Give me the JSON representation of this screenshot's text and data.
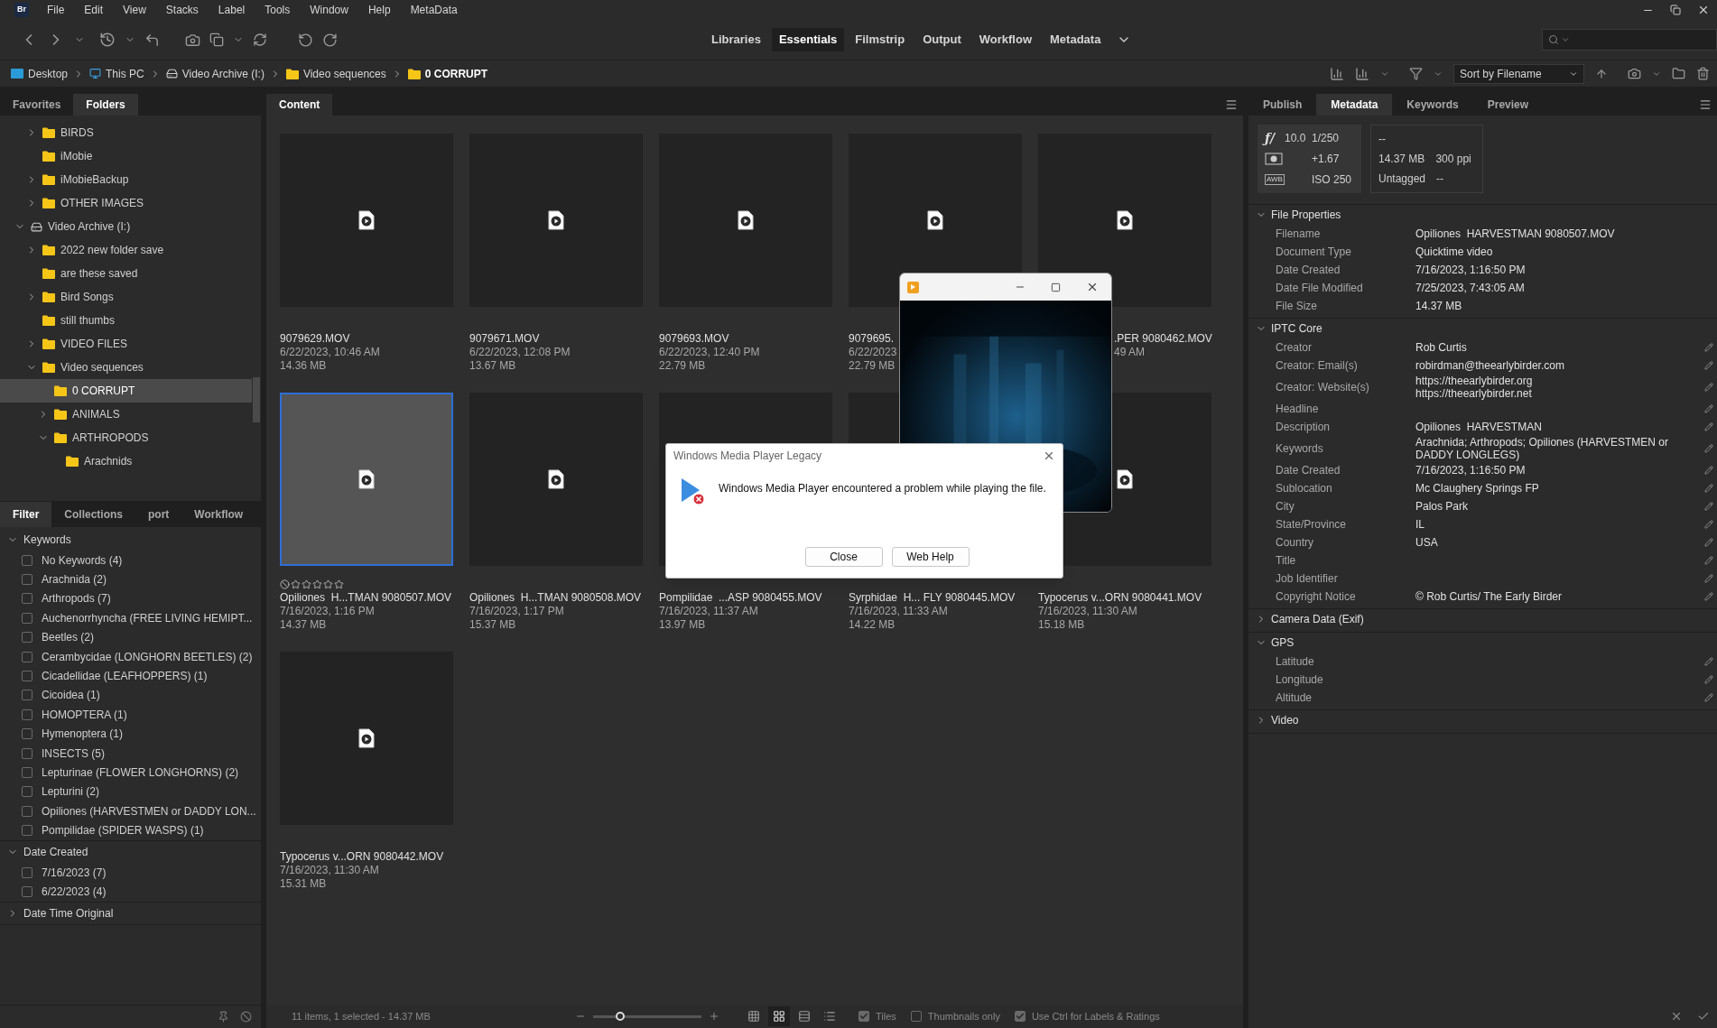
{
  "app": {
    "logo": "Br"
  },
  "menu": [
    "File",
    "Edit",
    "View",
    "Stacks",
    "Label",
    "Tools",
    "Window",
    "Help",
    "MetaData"
  ],
  "workspaces": [
    {
      "label": "Libraries",
      "selected": false
    },
    {
      "label": "Essentials",
      "selected": true
    },
    {
      "label": "Filmstrip",
      "selected": false
    },
    {
      "label": "Output",
      "selected": false
    },
    {
      "label": "Workflow",
      "selected": false
    },
    {
      "label": "Metadata",
      "selected": false
    }
  ],
  "path": [
    {
      "kind": "desktop",
      "label": "Desktop"
    },
    {
      "kind": "pc",
      "label": "This PC"
    },
    {
      "kind": "drive",
      "label": "Video Archive (I:)"
    },
    {
      "kind": "folder",
      "label": "Video sequences"
    },
    {
      "kind": "folder",
      "label": "0 CORRUPT"
    }
  ],
  "sort": {
    "value": "Sort by Filename"
  },
  "left_tabs": [
    {
      "label": "Favorites",
      "selected": false
    },
    {
      "label": "Folders",
      "selected": true
    }
  ],
  "folders": [
    {
      "kind": "folder",
      "label": "BIRDS",
      "expandable": true,
      "expanded": false,
      "selected": false
    },
    {
      "kind": "folder",
      "label": "iMobie",
      "expandable": false,
      "expanded": false,
      "selected": false
    },
    {
      "kind": "folder",
      "label": "iMobieBackup",
      "expandable": true,
      "expanded": false,
      "selected": false
    },
    {
      "kind": "folder",
      "label": "OTHER IMAGES",
      "expandable": true,
      "expanded": false,
      "selected": false
    },
    {
      "kind": "drive",
      "label": "Video Archive (I:)",
      "expandable": true,
      "expanded": true,
      "selected": false,
      "children": [
        {
          "kind": "folder",
          "label": "2022 new folder save",
          "expandable": true,
          "expanded": false,
          "selected": false
        },
        {
          "kind": "folder",
          "label": "are these saved",
          "expandable": false,
          "expanded": false,
          "selected": false
        },
        {
          "kind": "folder",
          "label": "Bird Songs",
          "expandable": true,
          "expanded": false,
          "selected": false
        },
        {
          "kind": "folder",
          "label": "still thumbs",
          "expandable": false,
          "expanded": false,
          "selected": false
        },
        {
          "kind": "folder",
          "label": "VIDEO FILES",
          "expandable": true,
          "expanded": false,
          "selected": false
        },
        {
          "kind": "folder",
          "label": "Video sequences",
          "expandable": true,
          "expanded": true,
          "selected": false,
          "children": [
            {
              "kind": "folder",
              "label": "0 CORRUPT",
              "expandable": false,
              "expanded": false,
              "selected": true
            },
            {
              "kind": "folder",
              "label": "ANIMALS",
              "expandable": true,
              "expanded": false,
              "selected": false
            },
            {
              "kind": "folder",
              "label": "ARTHROPODS",
              "expandable": true,
              "expanded": true,
              "selected": false,
              "children": [
                {
                  "kind": "folder",
                  "label": "Arachnids",
                  "expandable": false,
                  "expanded": false,
                  "selected": false
                }
              ]
            }
          ]
        }
      ]
    }
  ],
  "filter_tabs": [
    {
      "label": "Filter",
      "selected": true
    },
    {
      "label": "Collections",
      "selected": false
    },
    {
      "label": "port",
      "selected": false
    },
    {
      "label": "Workflow",
      "selected": false
    }
  ],
  "filter_sections": [
    {
      "title": "Keywords",
      "expanded": true,
      "items": [
        {
          "label": "No Keywords (4)",
          "checked": false
        },
        {
          "label": "Arachnida (2)",
          "checked": false
        },
        {
          "label": "Arthropods (7)",
          "checked": false
        },
        {
          "label": "Auchenorrhyncha (FREE LIVING HEMIPT...",
          "checked": false
        },
        {
          "label": "Beetles (2)",
          "checked": false
        },
        {
          "label": "Cerambycidae (LONGHORN BEETLES) (2)",
          "checked": false
        },
        {
          "label": "Cicadellidae (LEAFHOPPERS) (1)",
          "checked": false
        },
        {
          "label": "Cicoidea (1)",
          "checked": false
        },
        {
          "label": "HOMOPTERA (1)",
          "checked": false
        },
        {
          "label": "Hymenoptera (1)",
          "checked": false
        },
        {
          "label": "INSECTS (5)",
          "checked": false
        },
        {
          "label": "Lepturinae (FLOWER LONGHORNS) (2)",
          "checked": false
        },
        {
          "label": "Lepturini (2)",
          "checked": false
        },
        {
          "label": "Opiliones (HARVESTMEN or DADDY LON...",
          "checked": false
        },
        {
          "label": "Pompilidae (SPIDER WASPS) (1)",
          "checked": false
        }
      ]
    },
    {
      "title": "Date Created",
      "expanded": true,
      "items": [
        {
          "label": "7/16/2023 (7)",
          "checked": false
        },
        {
          "label": "6/22/2023 (4)",
          "checked": false
        }
      ]
    },
    {
      "title": "Date Time Original",
      "expanded": false
    }
  ],
  "content_tab": "Content",
  "tiles": [
    {
      "kind": "video",
      "name": "9079629.MOV",
      "date": "6/22/2023, 10:46 AM",
      "size": "14.36 MB",
      "selected": false
    },
    {
      "kind": "video",
      "name": "9079671.MOV",
      "date": "6/22/2023, 12:08 PM",
      "size": "13.67 MB",
      "selected": false
    },
    {
      "kind": "video",
      "name": "9079693.MOV",
      "date": "6/22/2023, 12:40 PM",
      "size": "22.79 MB",
      "selected": false
    },
    {
      "kind": "video",
      "name": "9079695.",
      "date": "6/22/2023",
      "size": "22.79 MB",
      "selected": false
    },
    {
      "kind": "video",
      "name": ".PER 9080462.MOV",
      "date": "49 AM",
      "selected": false,
      "partly_hidden": true
    },
    {
      "kind": "video",
      "name": "Opiliones  H...TMAN 9080507.MOV",
      "date": "7/16/2023, 1:16 PM",
      "size": "14.37 MB",
      "selected": true,
      "stars": 0
    },
    {
      "kind": "video",
      "name": "Opiliones  H...TMAN 9080508.MOV",
      "date": "7/16/2023, 1:17 PM",
      "size": "15.37 MB",
      "selected": false
    },
    {
      "name": "Pompilidae  ...ASP 9080455.MOV",
      "date": "7/16/2023, 11:37 AM",
      "size": "13.97 MB",
      "selected": false
    },
    {
      "name": "Syrphidae  H... FLY 9080445.MOV",
      "date": "7/16/2023, 11:33 AM",
      "size": "14.22 MB",
      "selected": false
    },
    {
      "kind": "video",
      "name": "Typocerus v...ORN 9080441.MOV",
      "date": "7/16/2023, 11:30 AM",
      "size": "15.18 MB",
      "selected": false
    },
    {
      "kind": "video",
      "name": "Typocerus v...ORN 9080442.MOV",
      "date": "7/16/2023, 11:30 AM",
      "size": "15.31 MB",
      "selected": false
    }
  ],
  "status": {
    "text": "11 items, 1 selected - 14.37 MB",
    "zoom": {
      "level": 0.25
    },
    "views": [
      {
        "kind": "grid",
        "selected": false
      },
      {
        "kind": "thumbnails",
        "selected": true
      },
      {
        "kind": "details",
        "selected": false
      },
      {
        "kind": "list",
        "selected": false
      }
    ],
    "options": [
      {
        "label": "Tiles",
        "checked": true
      },
      {
        "label": "Thumbnails only",
        "checked": false
      },
      {
        "label": "Use Ctrl for Labels & Ratings",
        "checked": true
      }
    ]
  },
  "right_tabs": [
    {
      "label": "Publish",
      "selected": false
    },
    {
      "label": "Metadata",
      "selected": true
    },
    {
      "label": "Keywords",
      "selected": false
    },
    {
      "label": "Preview",
      "selected": false
    }
  ],
  "camera": {
    "aperture_symbol": "ƒ/",
    "aperture": "10.0",
    "shutter": "1/250",
    "exposure": "+1.67",
    "wb": "AWB",
    "iso": "ISO 250",
    "info": [
      [
        "--"
      ],
      [
        "14.37 MB",
        "300 ppi"
      ],
      [
        "Untagged",
        "--"
      ]
    ]
  },
  "sections": [
    {
      "title": "File Properties",
      "expanded": true,
      "rows": [
        {
          "label": "Filename",
          "value": "Opiliones  HARVESTMAN 9080507.MOV",
          "editable": false
        },
        {
          "label": "Document Type",
          "value": "Quicktime video",
          "editable": false
        },
        {
          "label": "Date Created",
          "value": "7/16/2023, 1:16:50 PM",
          "editable": false
        },
        {
          "label": "Date File Modified",
          "value": "7/25/2023, 7:43:05 AM",
          "editable": false
        },
        {
          "label": "File Size",
          "value": "14.37 MB",
          "editable": false
        }
      ]
    },
    {
      "title": "IPTC Core",
      "expanded": true,
      "rows": [
        {
          "label": "Creator",
          "value": "Rob Curtis",
          "editable": true
        },
        {
          "label": "Creator: Email(s)",
          "value": "robirdman@theearlybirder.com",
          "editable": true
        },
        {
          "label": "Creator: Website(s)",
          "values": [
            "https://theearlybirder.org",
            "https://theearlybirder.net"
          ],
          "editable": true
        },
        {
          "label": "Headline",
          "editable": true
        },
        {
          "label": "Description",
          "value": "Opiliones  HARVESTMAN",
          "editable": true
        },
        {
          "label": "Keywords",
          "value": "Arachnida; Arthropods; Opiliones (HARVESTMEN or DADDY LONGLEGS)",
          "editable": true
        },
        {
          "label": "Date Created",
          "value": "7/16/2023, 1:16:50 PM",
          "editable": true
        },
        {
          "label": "Sublocation",
          "value": "Mc Claughery Springs FP",
          "editable": true
        },
        {
          "label": "City",
          "value": "Palos Park",
          "editable": true
        },
        {
          "label": "State/Province",
          "value": "IL",
          "editable": true
        },
        {
          "label": "Country",
          "value": "USA",
          "editable": true
        },
        {
          "label": "Title",
          "editable": true
        },
        {
          "label": "Job Identifier",
          "editable": true
        },
        {
          "label": "Copyright Notice",
          "value": "© Rob Curtis/ The Early Birder",
          "editable": true
        }
      ]
    },
    {
      "title": "Camera Data (Exif)",
      "expanded": false
    },
    {
      "title": "GPS",
      "expanded": true,
      "rows": [
        {
          "label": "Latitude",
          "editable": true
        },
        {
          "label": "Longitude",
          "editable": true
        },
        {
          "label": "Altitude",
          "editable": true
        }
      ]
    },
    {
      "title": "Video",
      "expanded": false
    }
  ],
  "error_dialog": {
    "title": "Windows Media Player Legacy",
    "message": "Windows Media Player encountered a problem while playing the file.",
    "buttons": [
      "Close",
      "Web Help"
    ]
  }
}
